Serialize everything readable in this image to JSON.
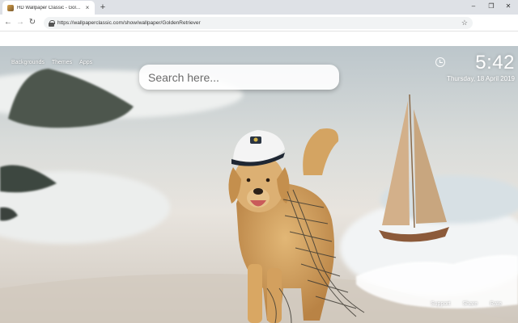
{
  "browser": {
    "tab_title": "HD Wallpaper Classic - GoldenRetriever",
    "tab_close": "×",
    "new_tab": "+",
    "window_controls": {
      "minimize": "–",
      "maximize": "❐",
      "close": "✕"
    },
    "nav": {
      "back": "←",
      "forward": "→",
      "reload": "↻"
    },
    "url": "https://wallpaperclassic.com/show/wallpaper/GoldenRetriever",
    "bookmark_star": "☆"
  },
  "page": {
    "nav_links": [
      {
        "label": "Backgrounds"
      },
      {
        "label": "Themes"
      },
      {
        "label": "Apps"
      }
    ],
    "search": {
      "placeholder": "Search here..."
    },
    "clock": {
      "time": "5:42",
      "date": "Thursday, 18 April 2019"
    },
    "footer_links": [
      {
        "label": "Support"
      },
      {
        "label": "Share"
      },
      {
        "label": "Rate"
      }
    ]
  },
  "colors": {
    "chrome_bg": "#dee1e6",
    "toolbar_bg": "#ffffff",
    "omnibox_bg": "#f1f3f4",
    "text_white": "#ffffff"
  },
  "icons": [
    "favicon-icon",
    "lock-icon",
    "star-icon",
    "clock-icon"
  ]
}
